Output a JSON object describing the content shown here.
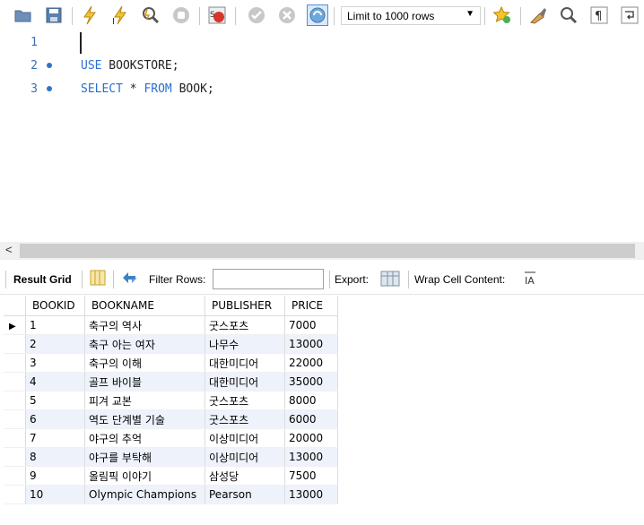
{
  "toolbar": {
    "limit_select_value": "Limit to 1000 rows",
    "icons": [
      "open-folder-icon",
      "save-icon",
      "execute-icon",
      "execute-current-icon",
      "explain-icon",
      "stop-icon",
      "toggle-error-icon",
      "commit-icon",
      "rollback-icon",
      "autocommit-icon",
      "limit-select",
      "bookmark-icon",
      "beautify-icon",
      "find-icon",
      "invisible-chars-icon",
      "wrap-icon"
    ]
  },
  "editor": {
    "lines": [
      {
        "num": "1",
        "keyword1": "",
        "text1": "",
        "keyword2": "",
        "text2": ""
      },
      {
        "num": "2",
        "keyword1": "USE",
        "text1": " BOOKSTORE;",
        "keyword2": "",
        "text2": ""
      },
      {
        "num": "3",
        "keyword1": "SELECT",
        "text1": " * ",
        "keyword2": "FROM",
        "text2": " BOOK;"
      }
    ]
  },
  "scroll": {
    "left_arrow": "<"
  },
  "result_bar": {
    "result_grid_label": "Result Grid",
    "filter_label": "Filter Rows:",
    "filter_value": "",
    "export_label": "Export:",
    "wrap_label": "Wrap Cell Content:"
  },
  "grid": {
    "columns": [
      "BOOKID",
      "BOOKNAME",
      "PUBLISHER",
      "PRICE"
    ],
    "current_row_marker": "▶",
    "rows": [
      [
        "1",
        "축구의 역사",
        "굿스포츠",
        "7000"
      ],
      [
        "2",
        "축구 아는 여자",
        "나무수",
        "13000"
      ],
      [
        "3",
        "축구의 이해",
        "대한미디어",
        "22000"
      ],
      [
        "4",
        "골프 바이블",
        "대한미디어",
        "35000"
      ],
      [
        "5",
        "피겨 교본",
        "굿스포츠",
        "8000"
      ],
      [
        "6",
        "역도 단계별 기술",
        "굿스포츠",
        "6000"
      ],
      [
        "7",
        "야구의 추억",
        "이상미디어",
        "20000"
      ],
      [
        "8",
        "야구를 부탁해",
        "이상미디어",
        "13000"
      ],
      [
        "9",
        "올림픽 이야기",
        "삼성당",
        "7500"
      ],
      [
        "10",
        "Olympic Champions",
        "Pearson",
        "13000"
      ]
    ]
  }
}
